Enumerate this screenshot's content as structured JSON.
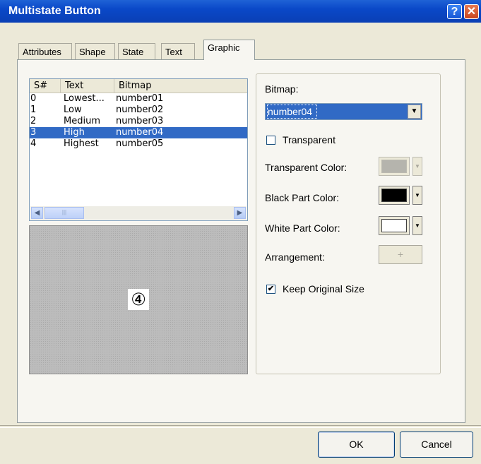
{
  "window": {
    "title": "Multistate Button",
    "help_label": "?",
    "close_label": "✕"
  },
  "tabs": [
    {
      "label": "Attributes",
      "active": false
    },
    {
      "label": "Shape",
      "active": false
    },
    {
      "label": "State",
      "active": false
    },
    {
      "label": "Text",
      "active": false
    },
    {
      "label": "Graphic",
      "active": true
    }
  ],
  "list": {
    "columns": [
      "S#",
      "Text",
      "Bitmap"
    ],
    "rows": [
      {
        "num": "0",
        "text": "Lowest...",
        "bitmap": "number01",
        "selected": false
      },
      {
        "num": "1",
        "text": "Low",
        "bitmap": "number02",
        "selected": false
      },
      {
        "num": "2",
        "text": "Medium",
        "bitmap": "number03",
        "selected": false
      },
      {
        "num": "3",
        "text": "High",
        "bitmap": "number04",
        "selected": true
      },
      {
        "num": "4",
        "text": "Highest",
        "bitmap": "number05",
        "selected": false
      }
    ],
    "scroll_left": "◀",
    "scroll_right": "▶",
    "thumb_grip": "|||"
  },
  "preview": {
    "glyph": "④"
  },
  "graphic": {
    "bitmap_label": "Bitmap:",
    "bitmap_value": "number04",
    "transparent_label": "Transparent",
    "transparent_checked": false,
    "transparent_color_label": "Transparent Color:",
    "black_part_label": "Black Part Color:",
    "white_part_label": "White Part Color:",
    "arrangement_label": "Arrangement:",
    "arrangement_icon": "+",
    "keep_size_label": "Keep Original Size",
    "keep_size_checked": true,
    "colors": {
      "transparent": "#b5b4ad",
      "black_part": "#000000",
      "white_part": "#ffffff"
    }
  },
  "buttons": {
    "ok": "OK",
    "cancel": "Cancel"
  }
}
